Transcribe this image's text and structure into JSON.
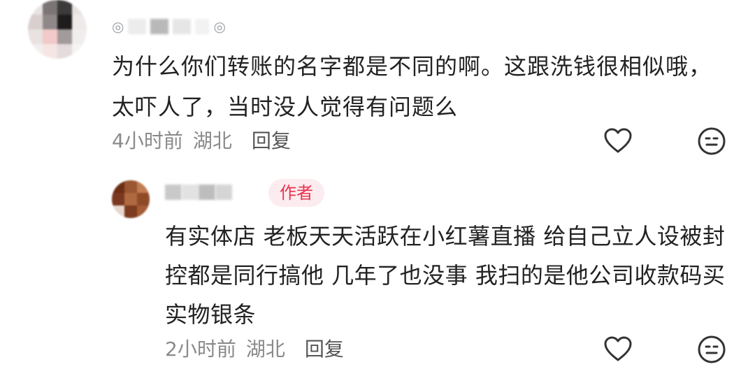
{
  "comment": {
    "username_visible": "◎　　　◎",
    "text": "为什么你们转账的名字都是不同的啊。这跟洗钱很相似哦，太吓人了，当时没人觉得有问题么",
    "time": "4小时前",
    "location": "湖北",
    "reply_label": "回复",
    "like_icon": "heart-outline-icon",
    "dislike_icon": "neutral-face-icon"
  },
  "reply": {
    "badge": "作者",
    "text": "有实体店 老板天天活跃在小红薯直播 给自己立人设被封控都是同行搞他 几年了也没事 我扫的是他公司收款码买实物银条",
    "time": "2小时前",
    "location": "湖北",
    "reply_label": "回复",
    "like_icon": "heart-outline-icon",
    "dislike_icon": "neutral-face-icon"
  },
  "colors": {
    "badge_text": "#e8344e",
    "badge_bg": "#fdecef",
    "meta_text": "#8a8a8a",
    "body_text": "#222222"
  }
}
